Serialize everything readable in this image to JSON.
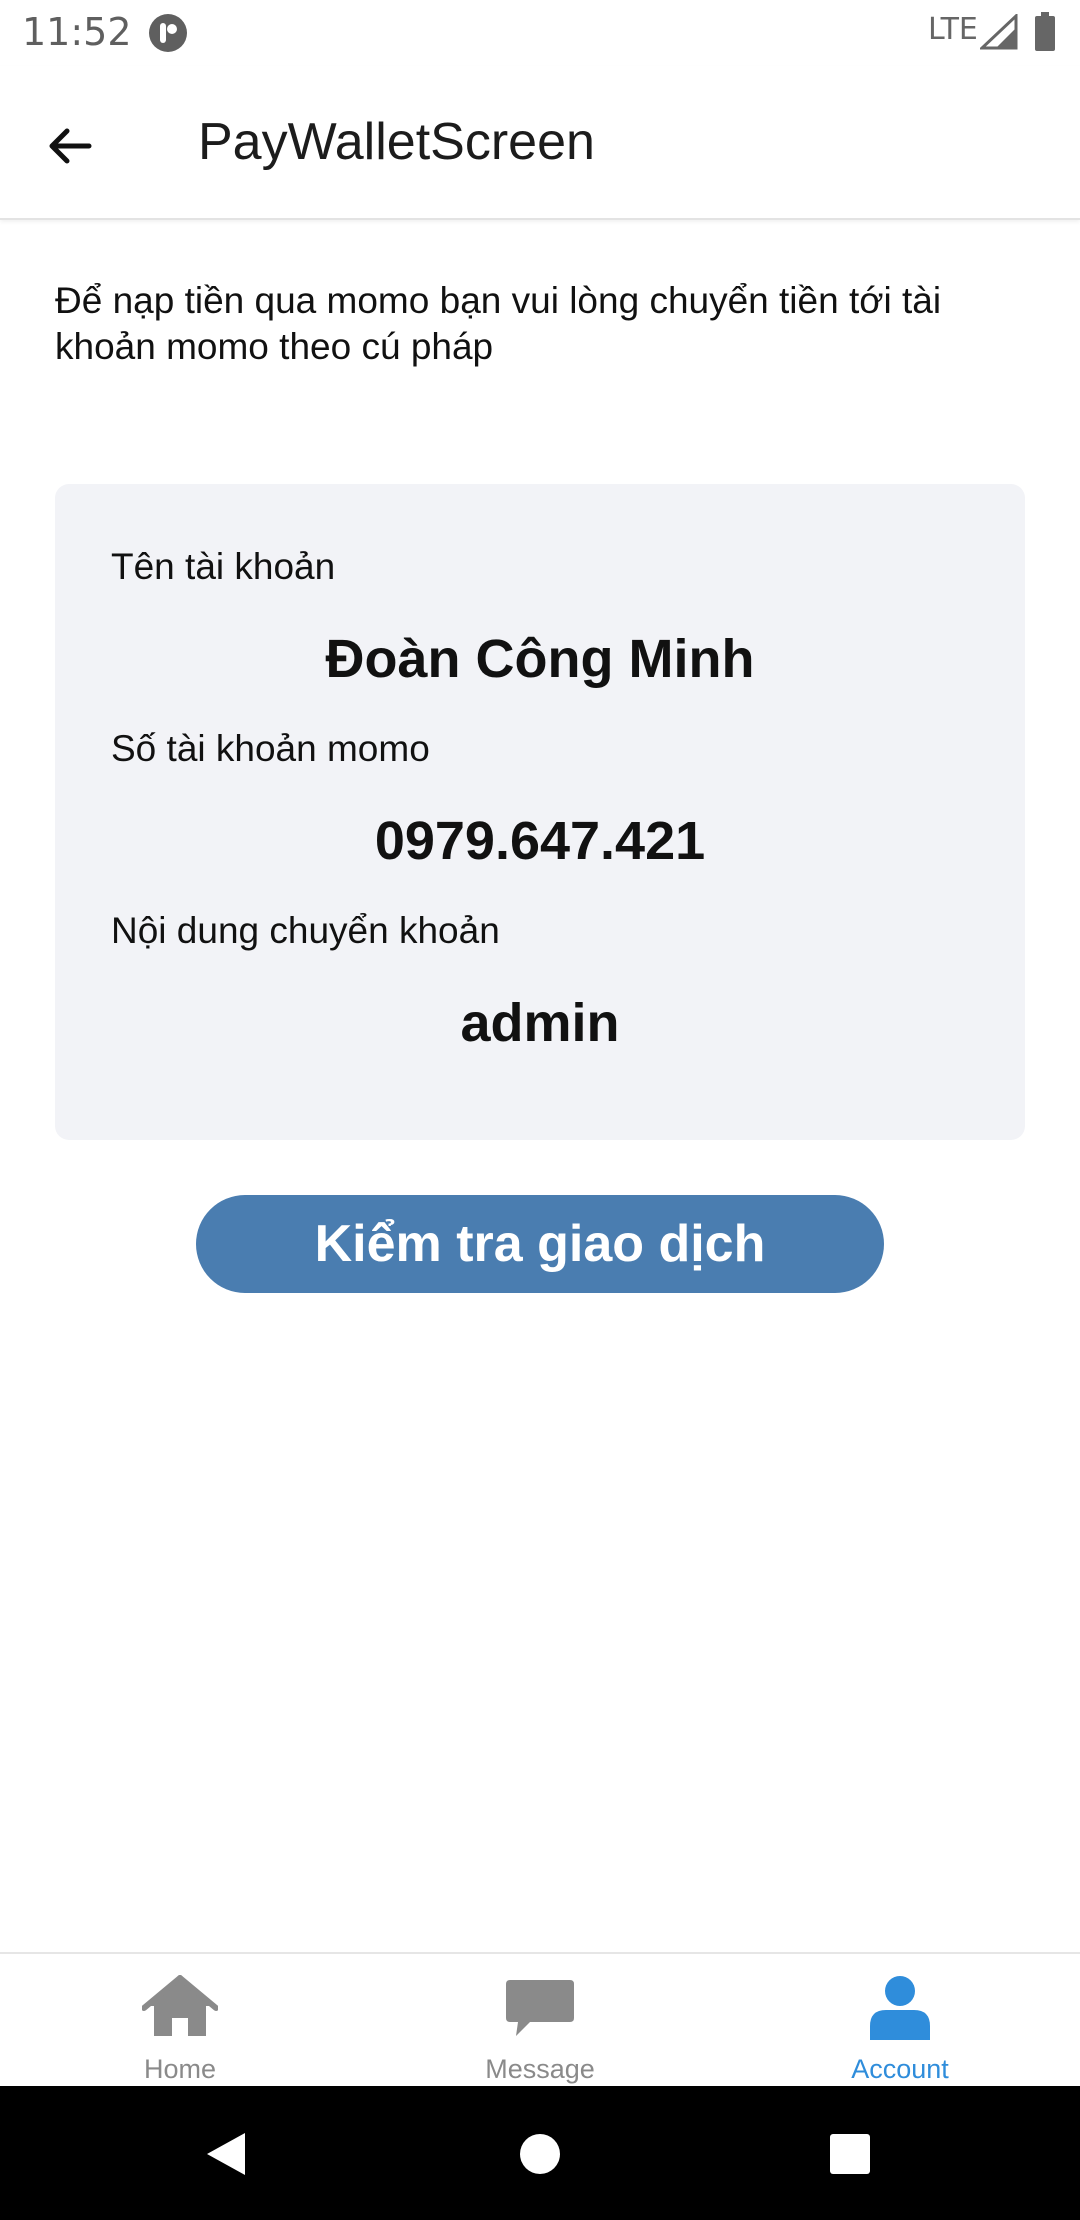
{
  "status_bar": {
    "time": "11:52",
    "network": "LTE",
    "icons": [
      "app-notification-icon",
      "signal-icon",
      "battery-icon"
    ]
  },
  "app_bar": {
    "title": "PayWalletScreen",
    "back_icon": "arrow-left-icon"
  },
  "intro": {
    "text": "Để nạp tiền qua momo bạn vui lòng chuyển tiền tới tài khoản momo theo cú pháp"
  },
  "card": {
    "account_name_label": "Tên tài khoản",
    "account_name_value": "Đoàn Công Minh",
    "account_number_label": "Số tài khoản momo",
    "account_number_value": "0979.647.421",
    "transfer_content_label": "Nội dung chuyển khoản",
    "transfer_content_value": "admin"
  },
  "actions": {
    "check_transaction_label": "Kiểm tra giao dịch"
  },
  "bottom_nav": {
    "tabs": [
      {
        "label": "Home",
        "icon": "home-icon",
        "active": false
      },
      {
        "label": "Message",
        "icon": "message-icon",
        "active": false
      },
      {
        "label": "Account",
        "icon": "account-icon",
        "active": true
      }
    ]
  },
  "colors": {
    "primary_button": "#4a7db0",
    "active_tab": "#2f8ddb",
    "inactive_tab": "#8a8a8a",
    "card_background": "#f2f3f7"
  }
}
